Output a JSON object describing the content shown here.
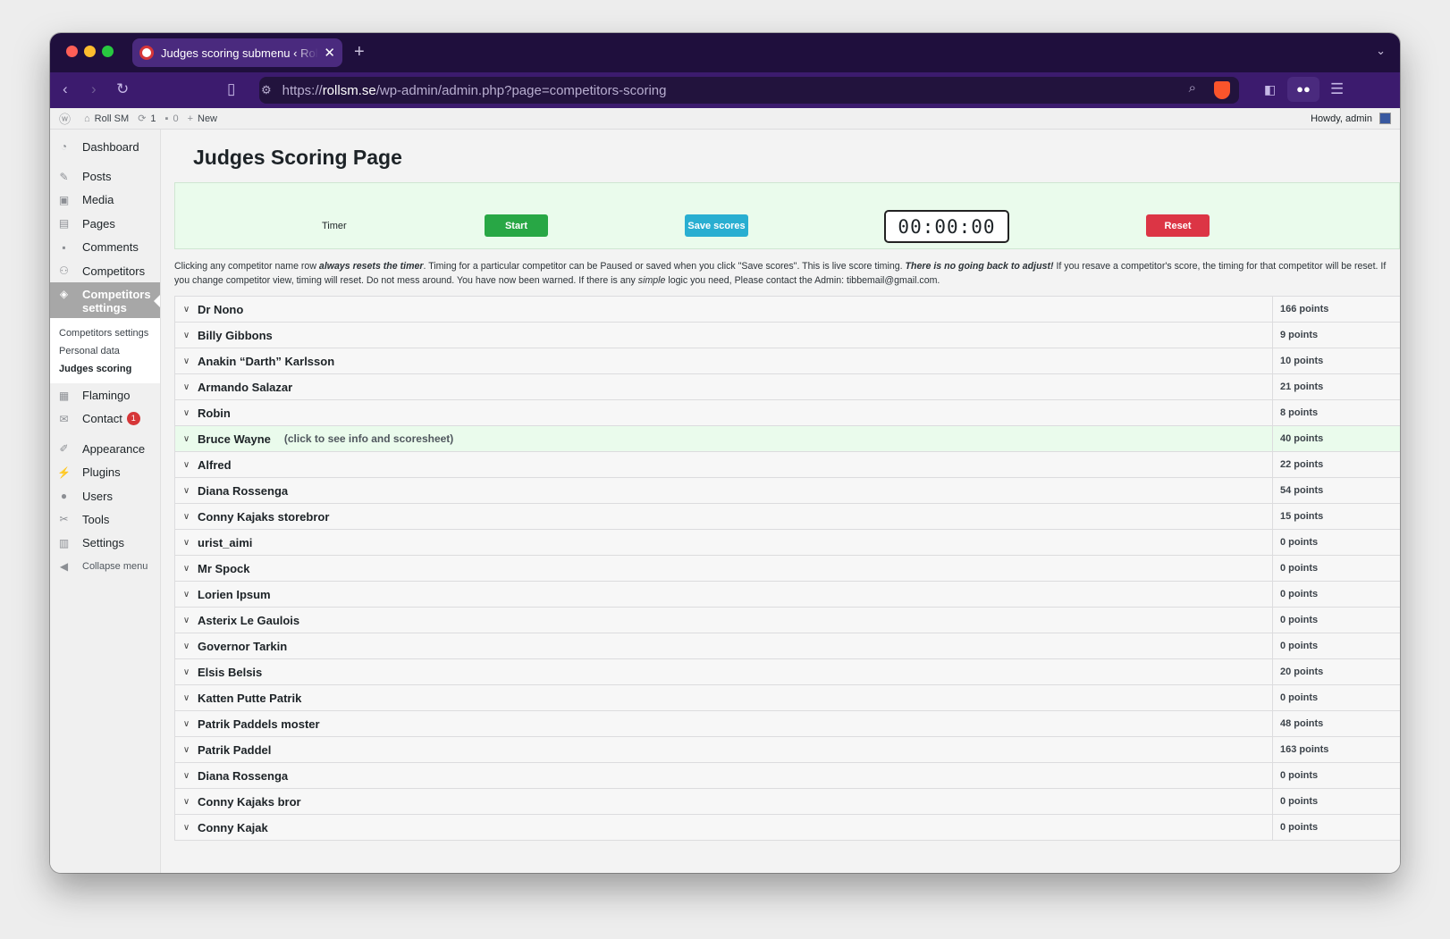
{
  "browser": {
    "tab_title": "Judges scoring submenu ‹ Roll SM — WordPress",
    "url_prefix": "https://",
    "url_host": "rollsm.se",
    "url_path": "/wp-admin/admin.php?page=competitors-scoring"
  },
  "adminbar": {
    "site": "Roll SM",
    "updates": "1",
    "comments": "0",
    "new": "New",
    "howdy": "Howdy, admin"
  },
  "sidebar": {
    "dashboard": "Dashboard",
    "posts": "Posts",
    "media": "Media",
    "pages": "Pages",
    "comments": "Comments",
    "competitors": "Competitors",
    "competitors_settings": "Competitors settings",
    "sub": [
      "Competitors settings",
      "Personal data",
      "Judges scoring"
    ],
    "flamingo": "Flamingo",
    "contact": "Contact",
    "contact_badge": "1",
    "appearance": "Appearance",
    "plugins": "Plugins",
    "users": "Users",
    "tools": "Tools",
    "settings": "Settings",
    "collapse": "Collapse menu"
  },
  "main": {
    "title": "Judges Scoring Page",
    "timer_label": "Timer",
    "start": "Start",
    "save": "Save scores",
    "clock": "00:00:00",
    "reset": "Reset",
    "notice": {
      "p1": "Clicking any competitor name row ",
      "b1": "always resets the timer",
      "p2": ". Timing for a particular competitor can be Paused or saved when you click \"Save scores\". This is live score timing. ",
      "b2": "There is no going back to adjust!",
      "p3": " If you resave a competitor's score, the timing for that competitor will be reset. If you change competitor view, timing will reset. Do not mess around. You have now been warned. If there is any ",
      "i1": "simple",
      "p4": " logic you need, Please contact the Admin: tibbemail@gmail.com."
    },
    "hint": "(click to see info and scoresheet)",
    "competitors": [
      {
        "name": "Dr Nono",
        "points": "166 points"
      },
      {
        "name": "Billy Gibbons",
        "points": "9 points"
      },
      {
        "name": "Anakin “Darth” Karlsson",
        "points": "10 points"
      },
      {
        "name": "Armando Salazar",
        "points": "21 points"
      },
      {
        "name": "Robin",
        "points": "8 points"
      },
      {
        "name": "Bruce Wayne",
        "points": "40 points"
      },
      {
        "name": "Alfred",
        "points": "22 points"
      },
      {
        "name": "Diana Rossenga",
        "points": "54 points"
      },
      {
        "name": "Conny Kajaks storebror",
        "points": "15 points"
      },
      {
        "name": "urist_aimi",
        "points": "0 points"
      },
      {
        "name": "Mr Spock",
        "points": "0 points"
      },
      {
        "name": "Lorien Ipsum",
        "points": "0 points"
      },
      {
        "name": "Asterix Le Gaulois",
        "points": "0 points"
      },
      {
        "name": "Governor Tarkin",
        "points": "0 points"
      },
      {
        "name": "Elsis Belsis",
        "points": "20 points"
      },
      {
        "name": "Katten Putte Patrik",
        "points": "0 points"
      },
      {
        "name": "Patrik Paddels moster",
        "points": "48 points"
      },
      {
        "name": "Patrik Paddel",
        "points": "163 points"
      },
      {
        "name": "Diana Rossenga",
        "points": "0 points"
      },
      {
        "name": "Conny Kajaks bror",
        "points": "0 points"
      },
      {
        "name": "Conny Kajak",
        "points": "0 points"
      }
    ]
  }
}
